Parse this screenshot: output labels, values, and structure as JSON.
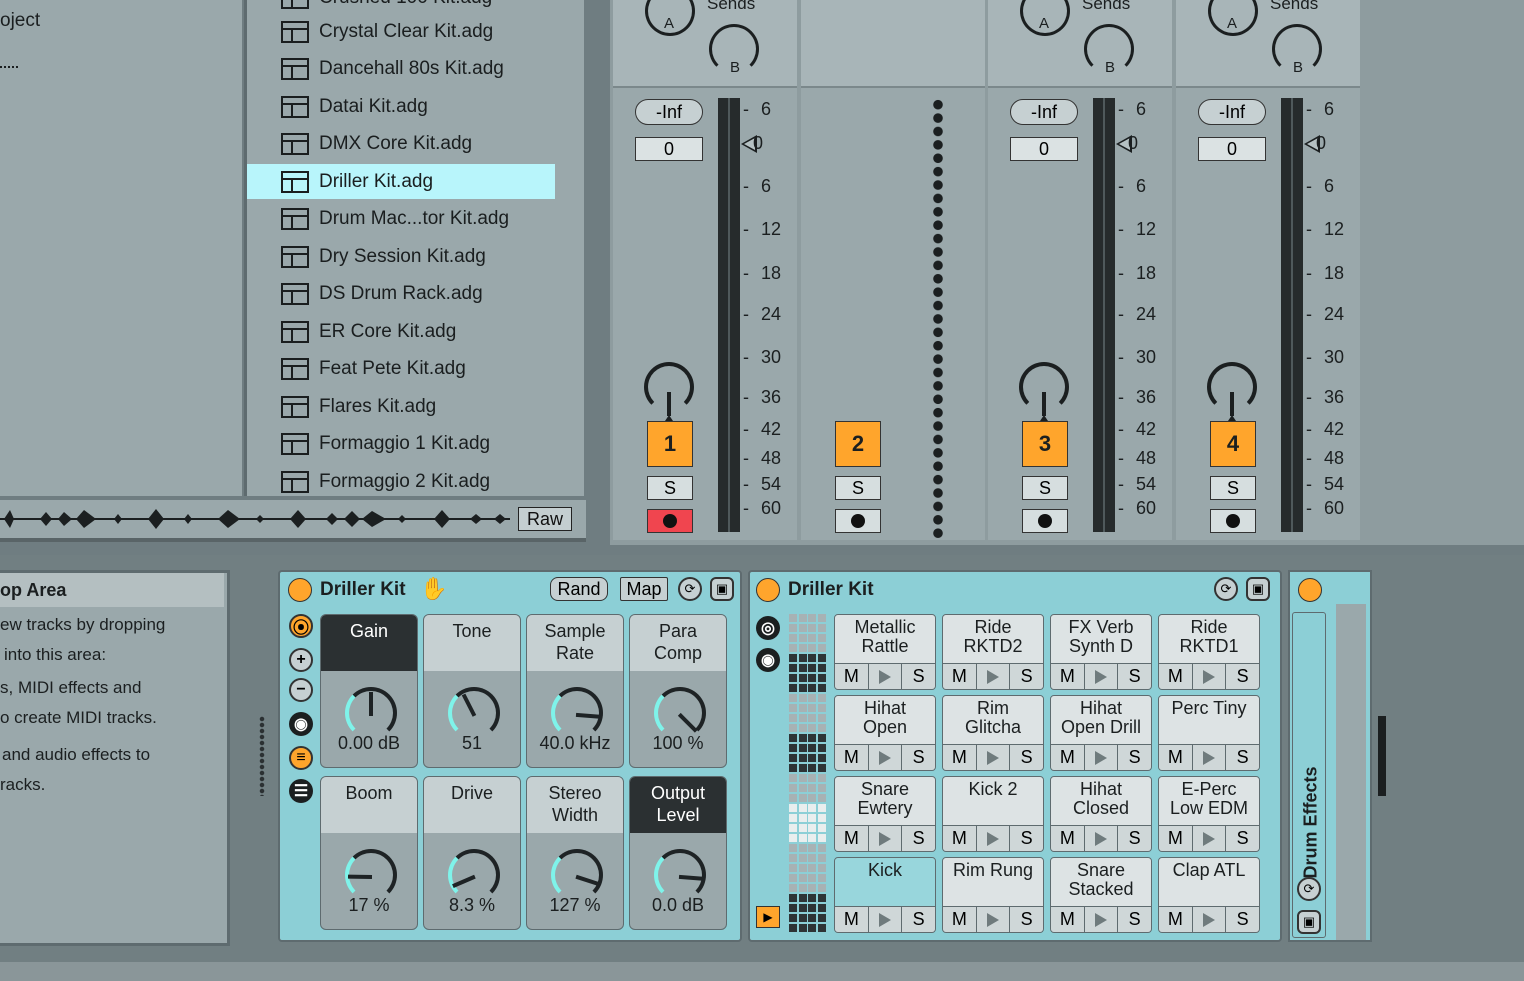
{
  "info": {
    "lines": [
      "oject",
      "..."
    ]
  },
  "browser": {
    "top_partial": "Crushed 100 Kit.adg",
    "items": [
      "Crystal Clear Kit.adg",
      "Dancehall 80s Kit.adg",
      "Datai Kit.adg",
      "DMX Core Kit.adg",
      "Driller Kit.adg",
      "Drum Mac...tor Kit.adg",
      "Dry Session Kit.adg",
      "DS Drum Rack.adg",
      "ER Core Kit.adg",
      "Feat Pete Kit.adg",
      "Flares Kit.adg",
      "Formaggio 1 Kit.adg",
      "Formaggio 2 Kit.adg"
    ],
    "selected": "Driller Kit.adg",
    "raw_label": "Raw"
  },
  "mixer": {
    "sends_label": "Sends",
    "send_a": "A",
    "send_b": "B",
    "scale": [
      "6",
      "0",
      "6",
      "12",
      "18",
      "24",
      "30",
      "36",
      "42",
      "48",
      "54",
      "60"
    ],
    "tracks": [
      {
        "number": "1",
        "volume": "-Inf",
        "pan": "0",
        "solo": "S",
        "arm_state": "armed"
      },
      {
        "number": "2",
        "solo": "S",
        "arm_state": "off"
      },
      {
        "number": "3",
        "volume": "-Inf",
        "pan": "0",
        "solo": "S",
        "arm_state": "off"
      },
      {
        "number": "4",
        "volume": "-Inf",
        "pan": "0",
        "solo": "S",
        "arm_state": "off"
      }
    ]
  },
  "drop_area": {
    "title": "op Area",
    "lines": [
      "ew tracks by dropping",
      "into this area:",
      "s, MIDI effects and",
      "o create MIDI tracks.",
      "and audio effects to",
      "racks."
    ]
  },
  "rack": {
    "title": "Driller Kit",
    "rand": "Rand",
    "map": "Map",
    "macros": [
      {
        "name": "Gain",
        "value": "0.00 dB",
        "level": 0.5,
        "dark": true
      },
      {
        "name": "Tone",
        "value": "51",
        "level": 0.4,
        "dark": false
      },
      {
        "name": "Sample\nRate",
        "value": "40.0 kHz",
        "level": 0.85,
        "dark": false
      },
      {
        "name": "Para\nComp",
        "value": "100 %",
        "level": 1.0,
        "dark": false
      },
      {
        "name": "Boom",
        "value": "17 %",
        "level": 0.17,
        "dark": false
      },
      {
        "name": "Drive",
        "value": "8.3 %",
        "level": 0.08,
        "dark": false
      },
      {
        "name": "Stereo\nWidth",
        "value": "127 %",
        "level": 0.9,
        "dark": false
      },
      {
        "name": "Output\nLevel",
        "value": "0.0 dB",
        "level": 0.85,
        "dark": true
      }
    ]
  },
  "drum_rack": {
    "title": "Driller Kit",
    "pads": [
      [
        "Metallic\nRattle",
        "Ride\nRKTD2",
        "FX Verb\nSynth D",
        "Ride\nRKTD1"
      ],
      [
        "Hihat\nOpen",
        "Rim\nGlitcha",
        "Hihat\nOpen Drill",
        "Perc Tiny"
      ],
      [
        "Snare\nEwtery",
        "Kick 2",
        "Hihat\nClosed",
        "E-Perc\nLow EDM"
      ],
      [
        "Kick",
        "Rim Rung",
        "Snare\nStacked",
        "Clap ATL"
      ]
    ],
    "selected_pad": "Kick",
    "m_label": "M",
    "s_label": "S"
  },
  "effects": {
    "label": "Drum Effects"
  },
  "colors": {
    "accent": "#ffa52c",
    "device_bg": "#8ccfd6",
    "selection": "#b8f5fb",
    "arm": "#f0454f"
  }
}
